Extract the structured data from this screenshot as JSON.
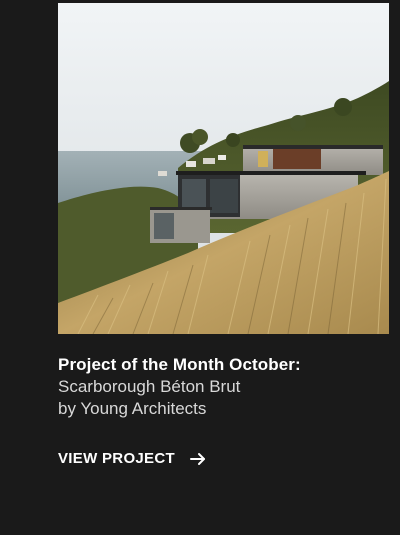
{
  "project_card": {
    "image": {
      "description_icon": "house-on-hillside-photo",
      "colors": {
        "sky_top": "#eef1f3",
        "sky_bottom": "#d9dee0",
        "sea": "#8e9ea4",
        "grass": "#b89a5c",
        "hill_green": "#4e5a2a"
      }
    },
    "title": "Project of the Month October:",
    "subtitle_line1": "Scarborough Béton Brut",
    "subtitle_line2": "by Young Architects",
    "cta": {
      "label": "VIEW PROJECT",
      "icon": "arrow-right-icon"
    }
  }
}
